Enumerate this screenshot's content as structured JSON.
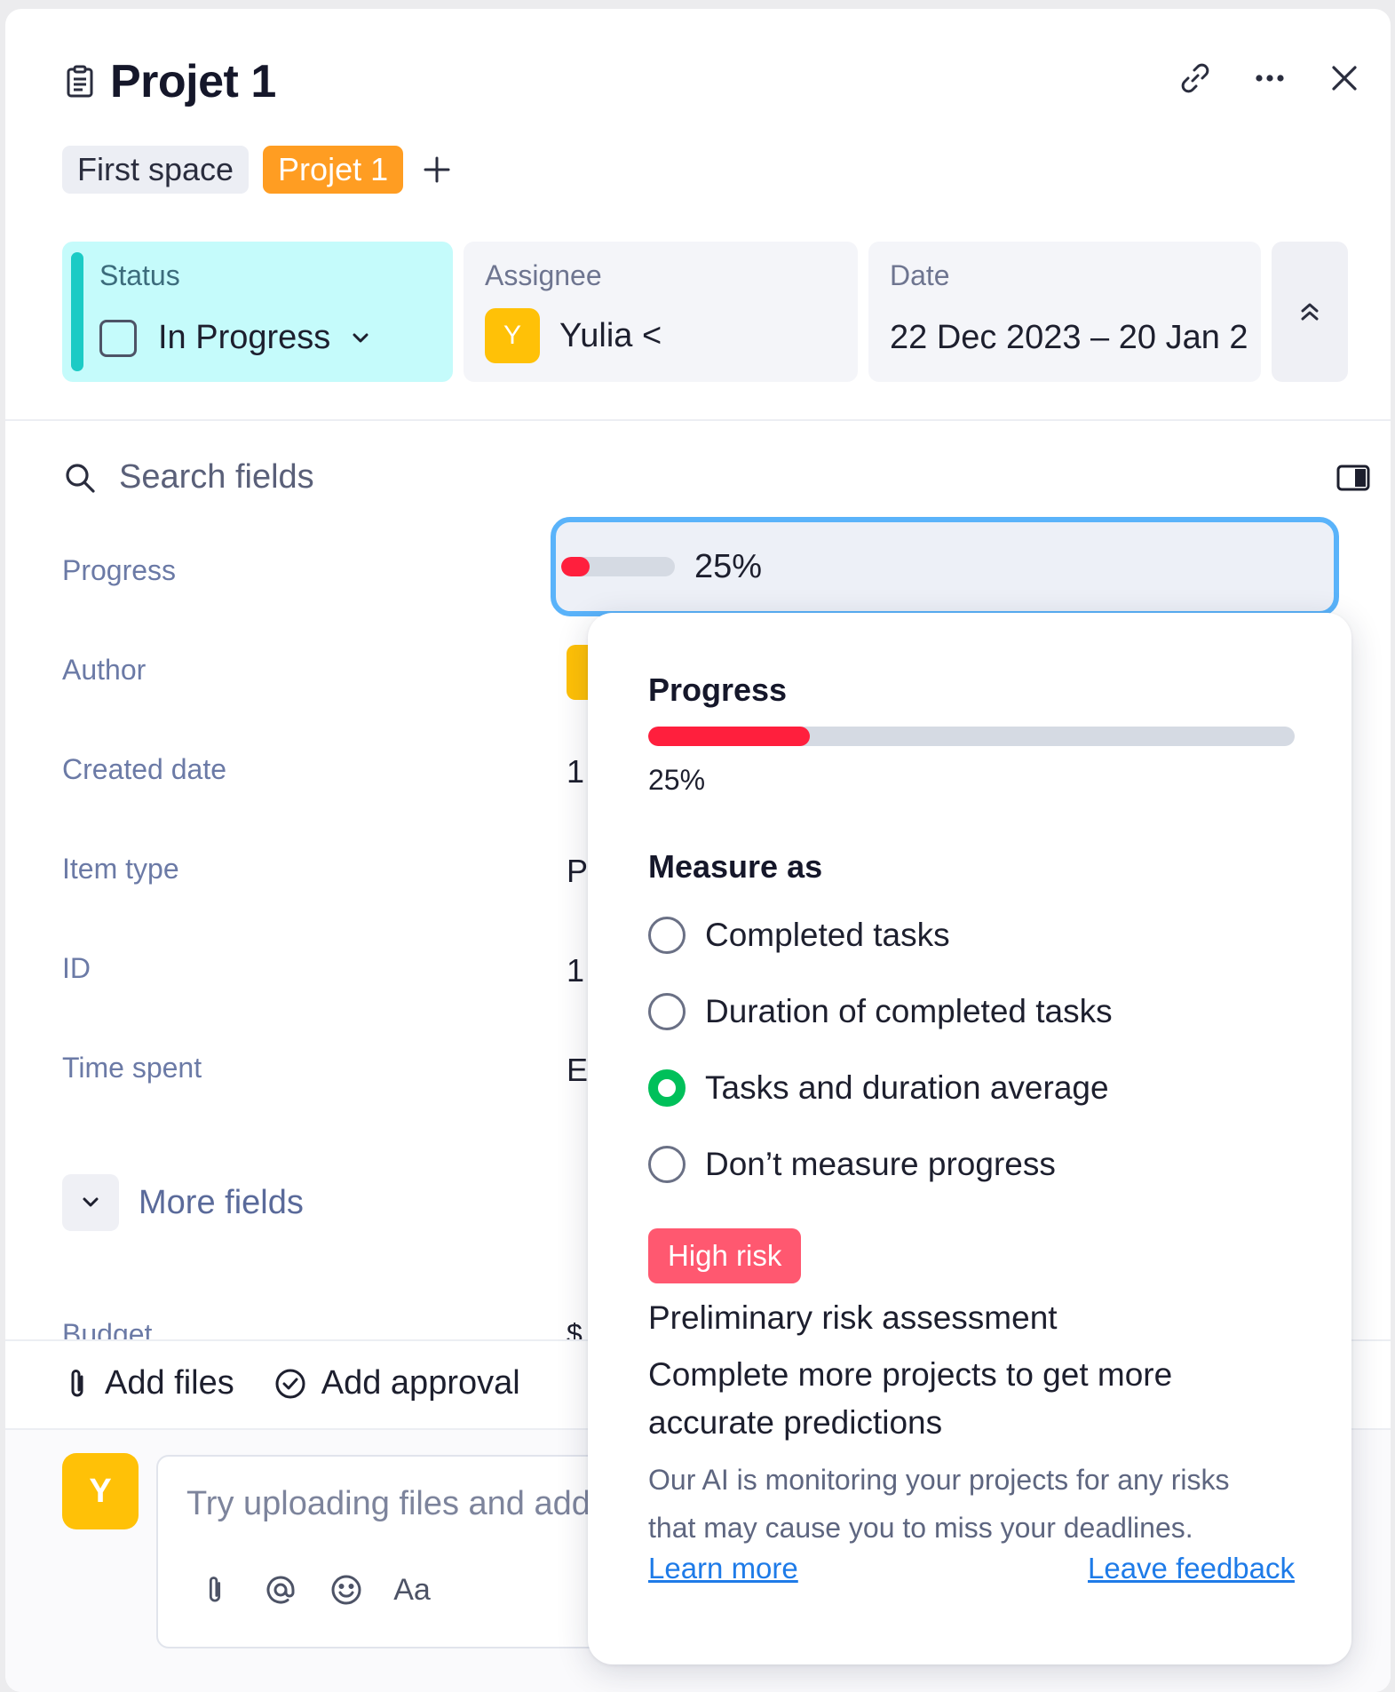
{
  "header": {
    "title": "Projet 1",
    "icons": [
      "document-icon",
      "link-icon",
      "more-icon",
      "close-icon"
    ]
  },
  "tags": {
    "space": "First space",
    "project": "Projet 1"
  },
  "cards": {
    "status": {
      "label": "Status",
      "value": "In Progress"
    },
    "assignee": {
      "label": "Assignee",
      "avatar": "Y",
      "value": "Yulia <"
    },
    "date": {
      "label": "Date",
      "value": "22 Dec 2023 – 20 Jan 2"
    }
  },
  "search": {
    "placeholder": "Search fields"
  },
  "fields": {
    "progress": {
      "label": "Progress",
      "value": "25%",
      "fraction": 0.25
    },
    "author": {
      "label": "Author"
    },
    "created_date": {
      "label": "Created date",
      "value": "1"
    },
    "item_type": {
      "label": "Item type",
      "value": "P"
    },
    "id": {
      "label": "ID",
      "value": "1"
    },
    "time_spent": {
      "label": "Time spent",
      "value": "E"
    },
    "more_fields": "More fields",
    "budget": {
      "label": "Budget",
      "value": "$"
    }
  },
  "actions": {
    "add_files": "Add files",
    "add_approval": "Add approval"
  },
  "composer": {
    "avatar": "Y",
    "placeholder": "Try uploading files and add",
    "format_label": "Aa"
  },
  "popover": {
    "title": "Progress",
    "percent_label": "25%",
    "fraction": 0.25,
    "measure_title": "Measure as",
    "options": [
      {
        "label": "Completed tasks",
        "checked": false
      },
      {
        "label": "Duration of completed tasks",
        "checked": false
      },
      {
        "label": "Tasks and duration average",
        "checked": true
      },
      {
        "label": "Don’t measure progress",
        "checked": false
      }
    ],
    "risk_badge": "High risk",
    "risk_title": "Preliminary risk assessment",
    "risk_message": "Complete more projects to get more accurate predictions",
    "risk_description_1": "Our AI is monitoring your projects for any risks",
    "risk_description_2": "that may cause you to miss your deadlines.",
    "learn_more": "Learn more",
    "leave_feedback": "Leave feedback"
  },
  "colors": {
    "status_bg": "#c5fbfb",
    "status_bar": "#1ccbc5",
    "project_tag": "#ff9d22",
    "avatar": "#ffc107",
    "progress_fill": "#ff1f3d",
    "focus_border": "#5ab3fa",
    "radio_checked": "#00c05a",
    "risk_badge": "#ff5870",
    "link": "#1e7be8"
  }
}
